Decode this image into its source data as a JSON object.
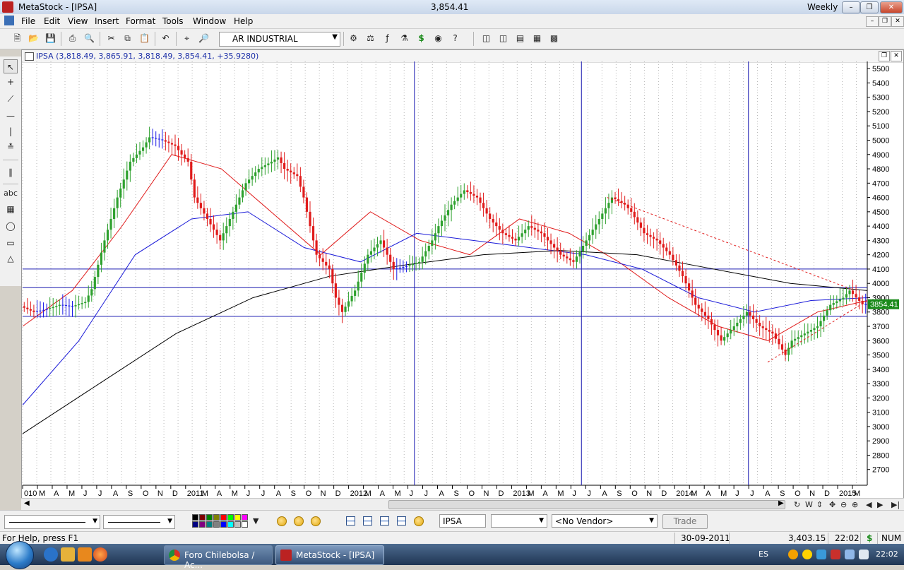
{
  "window": {
    "title": "MetaStock - [IPSA]",
    "price": "3,854.41",
    "period": "Weekly"
  },
  "menu": [
    "File",
    "Edit",
    "View",
    "Insert",
    "Format",
    "Tools",
    "Window",
    "Help"
  ],
  "toolbar": {
    "security": "AR INDUSTRIAL"
  },
  "chart_header": {
    "ohlc": "IPSA (3,818.49, 3,865.91, 3,818.49, 3,854.41, +35.9280)"
  },
  "chart_data": {
    "type": "candlestick",
    "title": "",
    "xlabel": "",
    "ylabel": "",
    "ylim": [
      2600,
      5550
    ],
    "y_ticks": [
      2700,
      2800,
      2900,
      3000,
      3100,
      3200,
      3300,
      3400,
      3500,
      3600,
      3700,
      3800,
      3900,
      4000,
      4100,
      4200,
      4300,
      4400,
      4500,
      4600,
      4700,
      4800,
      4900,
      5000,
      5100,
      5200,
      5300,
      5400,
      5500
    ],
    "x_labels": [
      "010",
      "M",
      "A",
      "M",
      "J",
      "J",
      "A",
      "S",
      "O",
      "N",
      "D",
      "2011",
      "M",
      "A",
      "M",
      "J",
      "J",
      "A",
      "S",
      "O",
      "N",
      "D",
      "2012",
      "M",
      "A",
      "M",
      "J",
      "J",
      "A",
      "S",
      "O",
      "N",
      "D",
      "2013",
      "M",
      "A",
      "M",
      "J",
      "J",
      "A",
      "S",
      "O",
      "N",
      "D",
      "2014",
      "M",
      "A",
      "M",
      "J",
      "J",
      "A",
      "S",
      "O",
      "N",
      "D",
      "2015",
      "M"
    ],
    "last_value_label": "3854.41",
    "horizontal_lines": [
      4100,
      3970,
      3770
    ],
    "vertical_line_weeks": [
      122,
      174,
      226
    ],
    "weeks": 263,
    "candles": [
      [
        0,
        3840
      ],
      [
        4,
        3800
      ],
      [
        8,
        3820
      ],
      [
        12,
        3850
      ],
      [
        16,
        3840
      ],
      [
        20,
        3870
      ],
      [
        22,
        3960
      ],
      [
        26,
        4300
      ],
      [
        30,
        4600
      ],
      [
        34,
        4850
      ],
      [
        38,
        4950
      ],
      [
        40,
        5020
      ],
      [
        44,
        5000
      ],
      [
        48,
        4960
      ],
      [
        50,
        4900
      ],
      [
        52,
        4850
      ],
      [
        54,
        4600
      ],
      [
        58,
        4450
      ],
      [
        62,
        4300
      ],
      [
        66,
        4500
      ],
      [
        70,
        4700
      ],
      [
        74,
        4800
      ],
      [
        78,
        4850
      ],
      [
        80,
        4880
      ],
      [
        82,
        4800
      ],
      [
        86,
        4750
      ],
      [
        88,
        4600
      ],
      [
        92,
        4200
      ],
      [
        96,
        4100
      ],
      [
        98,
        3900
      ],
      [
        100,
        3800
      ],
      [
        104,
        3950
      ],
      [
        108,
        4200
      ],
      [
        112,
        4300
      ],
      [
        116,
        4100
      ],
      [
        120,
        4120
      ],
      [
        124,
        4150
      ],
      [
        128,
        4300
      ],
      [
        130,
        4400
      ],
      [
        134,
        4550
      ],
      [
        138,
        4650
      ],
      [
        142,
        4600
      ],
      [
        146,
        4450
      ],
      [
        150,
        4350
      ],
      [
        154,
        4300
      ],
      [
        158,
        4400
      ],
      [
        162,
        4350
      ],
      [
        166,
        4250
      ],
      [
        168,
        4200
      ],
      [
        172,
        4150
      ],
      [
        176,
        4300
      ],
      [
        180,
        4450
      ],
      [
        184,
        4600
      ],
      [
        188,
        4550
      ],
      [
        190,
        4500
      ],
      [
        194,
        4350
      ],
      [
        198,
        4300
      ],
      [
        202,
        4200
      ],
      [
        206,
        4050
      ],
      [
        210,
        3850
      ],
      [
        214,
        3750
      ],
      [
        218,
        3600
      ],
      [
        222,
        3700
      ],
      [
        226,
        3800
      ],
      [
        230,
        3700
      ],
      [
        234,
        3650
      ],
      [
        238,
        3500
      ],
      [
        240,
        3600
      ],
      [
        244,
        3650
      ],
      [
        248,
        3700
      ],
      [
        252,
        3850
      ],
      [
        256,
        3900
      ],
      [
        258,
        3950
      ],
      [
        262,
        3854
      ]
    ],
    "series": [
      {
        "values": [
          3700,
          3950,
          4400,
          4900,
          4800,
          4500,
          4200,
          4500,
          4300,
          4200,
          4450,
          4350,
          4150,
          3900,
          3700,
          3600,
          3800,
          3880
        ]
      },
      {
        "values": [
          3150,
          3600,
          4200,
          4450,
          4500,
          4250,
          4150,
          4350,
          4300,
          4250,
          4200,
          4100,
          3900,
          3800,
          3880,
          3900
        ]
      },
      {
        "values": [
          2950,
          3300,
          3650,
          3900,
          4050,
          4130,
          4200,
          4230,
          4200,
          4100,
          4000,
          3950
        ]
      }
    ],
    "trendlines": [
      {
        "from": [
          182,
          4600
        ],
        "to": [
          258,
          3960
        ],
        "style": "dashed"
      },
      {
        "from": [
          232,
          3450
        ],
        "to": [
          263,
          3880
        ],
        "style": "dashed"
      }
    ]
  },
  "bottom_toolbar": {
    "symbol": "IPSA",
    "vendor": "<No Vendor>",
    "trade": "Trade"
  },
  "status": {
    "help": "For Help, press F1",
    "date": "30-09-2011",
    "value": "3,403.15",
    "time": "22:02",
    "num": "NUM"
  },
  "taskbar": {
    "tasks": [
      {
        "label": "Foro Chilebolsa / Ac..."
      },
      {
        "label": "MetaStock - [IPSA]"
      }
    ],
    "lang": "ES",
    "clock": "22:02"
  },
  "colors": {
    "up": "#2ea12e",
    "down": "#e01b1b",
    "flat": "#1a1ae6",
    "ma_short": "#e01b1b",
    "ma_mid": "#1a1ad8",
    "ma_long": "#000000",
    "hline": "#1a1ab0"
  }
}
